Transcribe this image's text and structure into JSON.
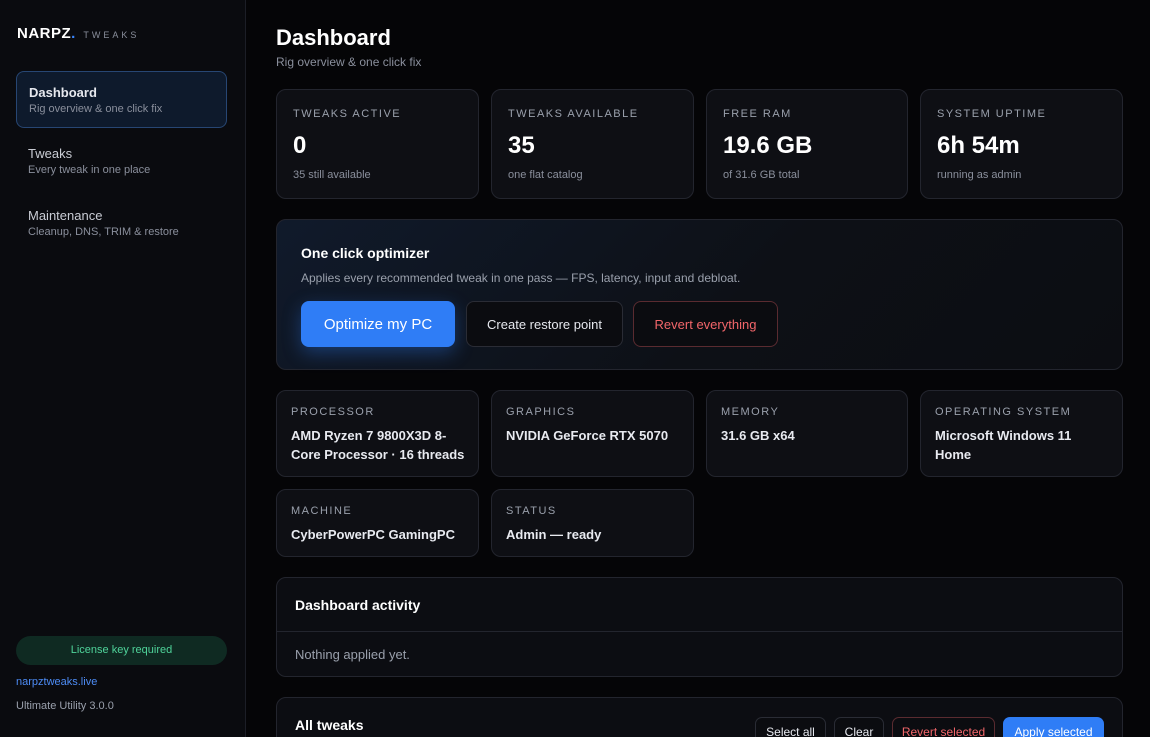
{
  "brand": {
    "logo": "NARPZ",
    "dot": ".",
    "subtitle": "TWEAKS"
  },
  "sidebar": {
    "items": [
      {
        "title": "Dashboard",
        "subtitle": "Rig overview & one click fix",
        "active": true
      },
      {
        "title": "Tweaks",
        "subtitle": "Every tweak in one place",
        "active": false
      },
      {
        "title": "Maintenance",
        "subtitle": "Cleanup, DNS, TRIM & restore",
        "active": false
      }
    ],
    "license": "License key required",
    "site": "narpztweaks.live",
    "version": "Ultimate Utility 3.0.0"
  },
  "header": {
    "title": "Dashboard",
    "subtitle": "Rig overview & one click fix"
  },
  "stats": [
    {
      "label": "TWEAKS ACTIVE",
      "value": "0",
      "sub": "35 still available"
    },
    {
      "label": "TWEAKS AVAILABLE",
      "value": "35",
      "sub": "one flat catalog"
    },
    {
      "label": "FREE RAM",
      "value": "19.6 GB",
      "sub": "of 31.6 GB total"
    },
    {
      "label": "SYSTEM UPTIME",
      "value": "6h 54m",
      "sub": "running as admin"
    }
  ],
  "optimizer": {
    "title": "One click optimizer",
    "subtitle": "Applies every recommended tweak in one pass — FPS, latency, input and debloat.",
    "optimize_label": "Optimize my PC",
    "restore_label": "Create restore point",
    "revert_label": "Revert everything"
  },
  "system": [
    {
      "label": "PROCESSOR",
      "value": "AMD Ryzen 7 9800X3D 8-Core Processor · 16 threads"
    },
    {
      "label": "GRAPHICS",
      "value": "NVIDIA GeForce RTX 5070"
    },
    {
      "label": "MEMORY",
      "value": "31.6 GB x64"
    },
    {
      "label": "OPERATING SYSTEM",
      "value": "Microsoft Windows 11 Home"
    },
    {
      "label": "MACHINE",
      "value": "CyberPowerPC GamingPC"
    },
    {
      "label": "STATUS",
      "value": "Admin — ready"
    }
  ],
  "activity": {
    "title": "Dashboard activity",
    "empty": "Nothing applied yet."
  },
  "tweaks": {
    "title": "All tweaks",
    "select_all": "Select all",
    "clear": "Clear",
    "revert_selected": "Revert selected",
    "apply_selected": "Apply selected"
  },
  "colors": {
    "accent": "#2f7df6",
    "danger": "#f2666a",
    "success": "#4fd39a"
  }
}
